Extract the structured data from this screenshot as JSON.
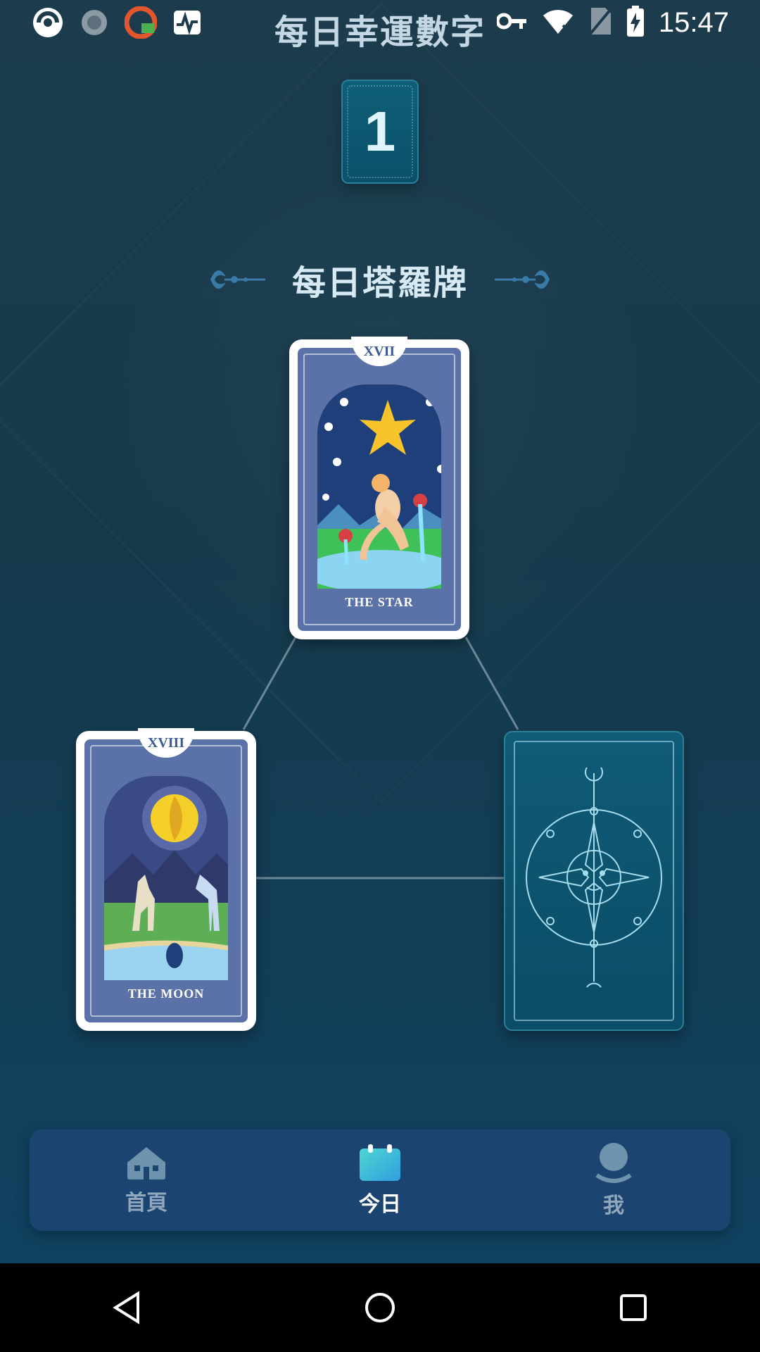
{
  "status_bar": {
    "title": "每日幸運數字",
    "time": "15:47"
  },
  "lucky_number": "1",
  "section_title": "每日塔羅牌",
  "cards": [
    {
      "numeral": "XVII",
      "name": "THE STAR",
      "state": "revealed"
    },
    {
      "numeral": "XVIII",
      "name": "THE MOON",
      "state": "revealed"
    },
    {
      "state": "face-down"
    }
  ],
  "tabs": [
    {
      "label": "首頁",
      "icon": "home-icon",
      "active": false
    },
    {
      "label": "今日",
      "icon": "calendar-icon",
      "active": true
    },
    {
      "label": "我",
      "icon": "profile-icon",
      "active": false
    }
  ],
  "colors": {
    "accent": "#4fd6d0",
    "tab_inactive": "#91a7bd",
    "card_blue": "#5a72a7"
  }
}
